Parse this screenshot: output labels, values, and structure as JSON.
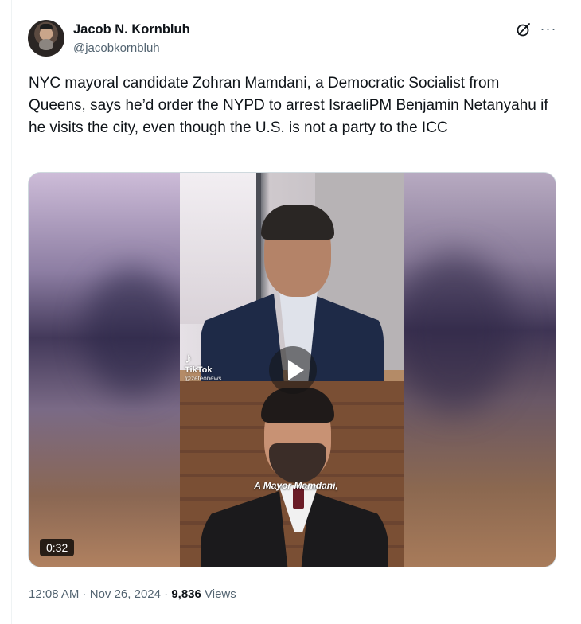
{
  "author": {
    "display_name": "Jacob N. Kornbluh",
    "handle": "@jacobkornbluh",
    "avatar_icon": "avatar-photo"
  },
  "header_actions": {
    "grok_icon": "grok-icon",
    "more_icon": "more-icon",
    "more_glyph": "···"
  },
  "tweet": {
    "text": "NYC mayoral candidate Zohran Mamdani, a Democratic Socialist from Queens, says he’d order the NYPD to arrest IsraeliPM Benjamin Netanyahu if he visits the city, even though the U.S. is not a party to the ICC"
  },
  "video": {
    "duration": "0:32",
    "caption": "A Mayor Mamdani,",
    "watermark_brand": "TikTok",
    "watermark_handle": "@zeteonews",
    "play_icon": "play-icon"
  },
  "meta": {
    "time": "12:08 AM",
    "separator": " · ",
    "date": "Nov 26, 2024",
    "views_count": "9,836",
    "views_label": " Views"
  },
  "colors": {
    "text_primary": "#0f1419",
    "text_secondary": "#536471",
    "border": "#cfd9de"
  }
}
